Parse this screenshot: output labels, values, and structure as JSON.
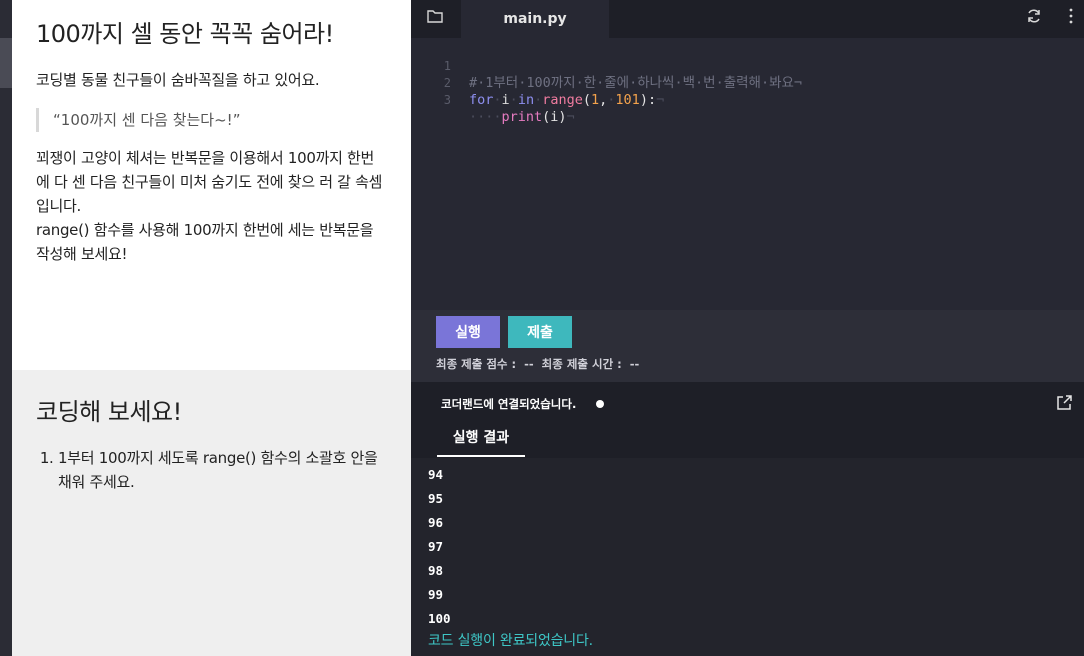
{
  "lesson": {
    "title": "100까지 셀 동안 꼭꼭 숨어라!",
    "intro": "코딩별 동물 친구들이 숨바꼭질을 하고 있어요.",
    "quote": "“100까지 센 다음 찾는다~!”",
    "desc_1": "꾀쟁이 고양이 체셔는 반복문을 이용해서 100까지 한번에 다 센 다음 친구들이 미처 숨기도 전에 찾으 러 갈 속셈입니다.",
    "desc_2": "range() 함수를 사용해 100까지 한번에 세는 반복문을 작성해 보세요!"
  },
  "task": {
    "title": "코딩해 보세요!",
    "items": [
      "1부터 100까지 세도록 range() 함수의 소괄호 안을 채워 주세요."
    ]
  },
  "editor": {
    "file_tab": "main.py",
    "icons": {
      "folder": "folder-icon",
      "refresh": "refresh-icon",
      "more": "more-vertical-icon"
    },
    "lines": [
      {
        "n": "1",
        "text": "# 1부터 100까지 한 줄에 하나씩 백 번 출력해 봐요"
      },
      {
        "n": "2",
        "text": "for i in range(1, 101):"
      },
      {
        "n": "3",
        "text": "    print(i)"
      }
    ]
  },
  "actions": {
    "run_label": "실행",
    "submit_label": "제출",
    "score_label": "최종 제출 점수 :",
    "score_value": "--",
    "time_label": "최종 제출 시간 :",
    "time_value": "--",
    "colors": {
      "run": "#7a75d8",
      "submit": "#3eb8bd"
    }
  },
  "output": {
    "connection": "코더랜드에 연결되었습니다.",
    "tab_label": "실행 결과",
    "lines": [
      "94",
      "95",
      "96",
      "97",
      "98",
      "99",
      "100"
    ],
    "done": "코드 실행이 완료되었습니다."
  }
}
